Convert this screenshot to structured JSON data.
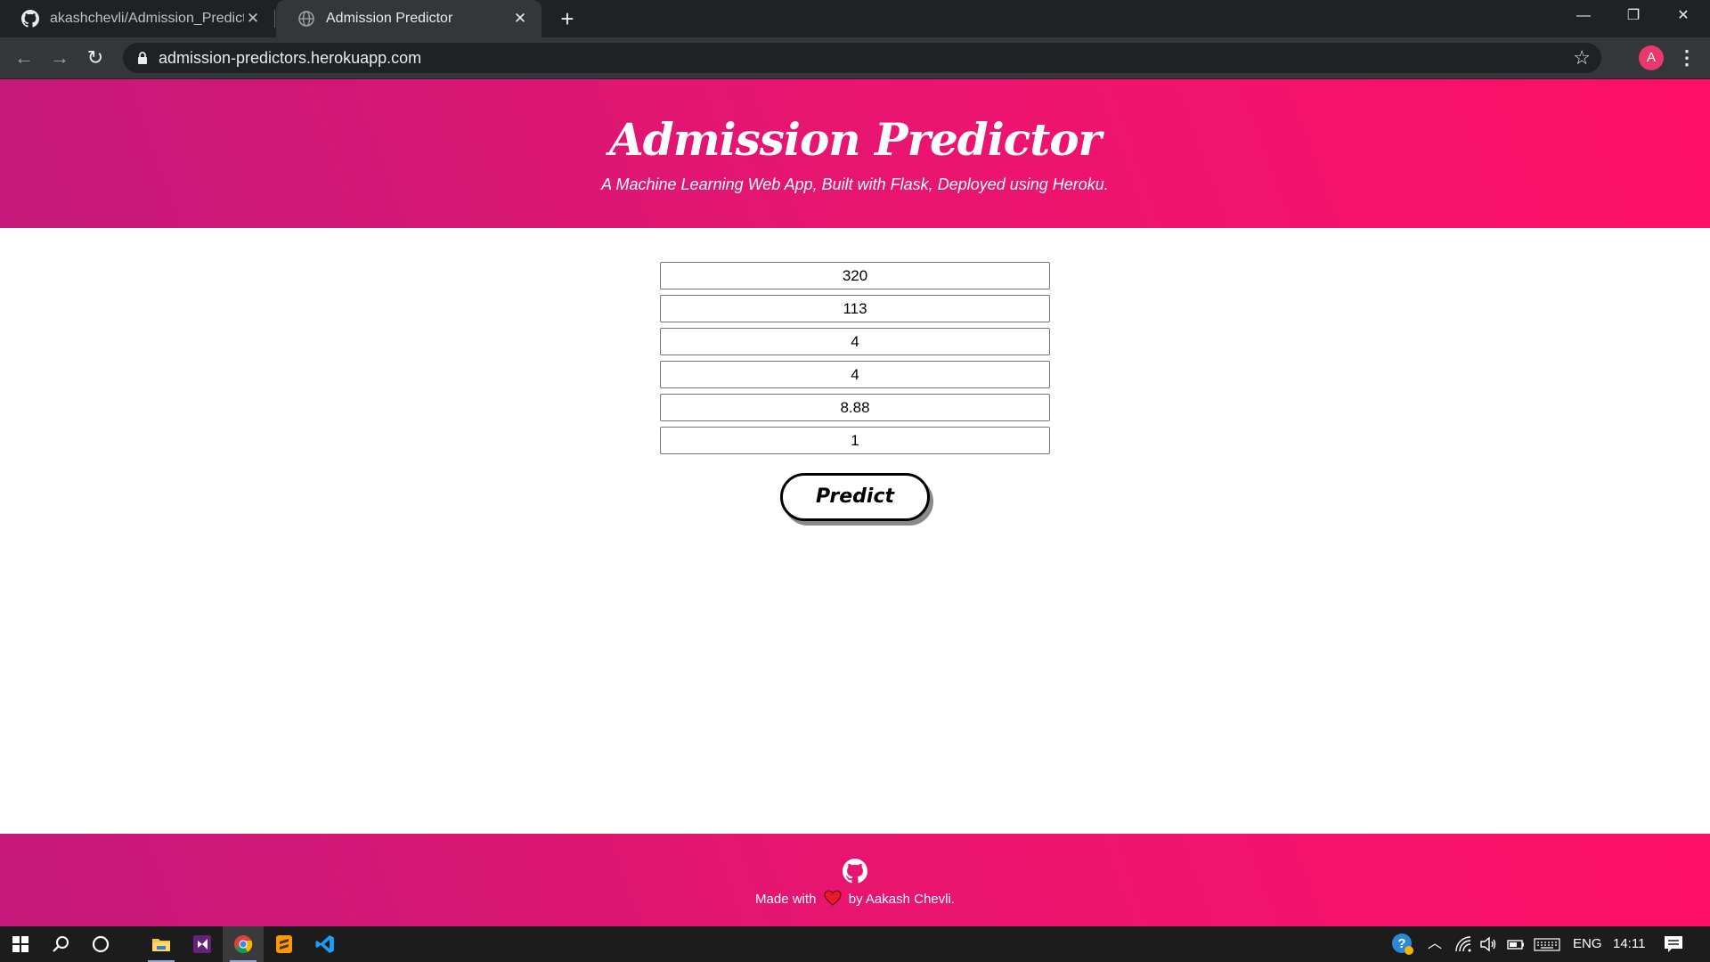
{
  "browser": {
    "tabs": [
      {
        "title": "akashchevli/Admission_Prediction",
        "icon": "github-icon",
        "active": false
      },
      {
        "title": "Admission Predictor",
        "icon": "globe-icon",
        "active": true
      }
    ],
    "url": "admission-predictors.herokuapp.com",
    "profile_initial": "A",
    "profile_color": "#e8386d"
  },
  "header": {
    "title": "Admission Predictor",
    "subtitle": "A Machine Learning Web App, Built with Flask, Deployed using Heroku."
  },
  "form": {
    "fields": [
      {
        "value": "320"
      },
      {
        "value": "113"
      },
      {
        "value": "4"
      },
      {
        "value": "4"
      },
      {
        "value": "8.88"
      },
      {
        "value": "1"
      }
    ],
    "submit_label": "Predict"
  },
  "footer": {
    "made_with": "Made with",
    "by": "by Aakash Chevli."
  },
  "taskbar": {
    "language": "ENG",
    "time": "14:11"
  },
  "colors": {
    "accent_start": "#c4197a",
    "accent_end": "#fe1066",
    "heart": "#e8192c"
  }
}
